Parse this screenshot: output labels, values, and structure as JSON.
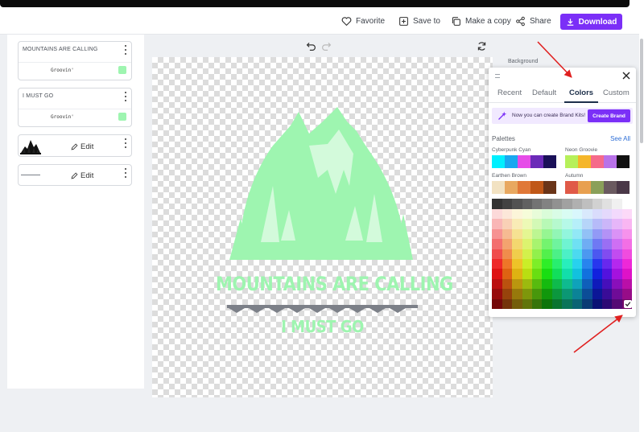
{
  "toolbar": {
    "favorite": "Favorite",
    "save_to": "Save to",
    "make_copy": "Make a copy",
    "share": "Share",
    "download": "Download"
  },
  "layers": [
    {
      "title": "MOUNTAINS ARE CALLING",
      "font": "Groovin'",
      "color": "#9ef5b0"
    },
    {
      "title": "I MUST GO",
      "font": "Groovin'",
      "color": "#9ef5b0"
    },
    {
      "edit_label": "Edit"
    },
    {
      "edit_label": "Edit"
    }
  ],
  "design": {
    "title_text": "MOUNTAINS ARE CALLING",
    "sub_text": "I MUST GO",
    "color": "#9ef5b0"
  },
  "background_label": "Background",
  "color_panel": {
    "tabs": [
      {
        "label": "Recent",
        "active": false
      },
      {
        "label": "Default",
        "active": false
      },
      {
        "label": "Colors",
        "active": true
      },
      {
        "label": "Custom",
        "active": false
      }
    ],
    "promo_text": "Now you can create Brand Kits!",
    "promo_button": "Create Brand",
    "palettes_label": "Palettes",
    "see_all": "See All",
    "palettes": [
      {
        "name": "Cyberpunk Cyan",
        "colors": [
          "#00f0ff",
          "#1aa8f0",
          "#e64ce8",
          "#6b2ab8",
          "#1a1058"
        ]
      },
      {
        "name": "Neon Groovie",
        "colors": [
          "#b6f05a",
          "#f5b62a",
          "#f56a8a",
          "#b872e8",
          "#111111"
        ]
      },
      {
        "name": "Earthen Brown",
        "colors": [
          "#f2e2c2",
          "#e8a860",
          "#e07838",
          "#c05818",
          "#6a3418"
        ]
      },
      {
        "name": "Autumn",
        "colors": [
          "#e05a48",
          "#e8a050",
          "#8aa05a",
          "#6a5a60",
          "#4a3848"
        ]
      }
    ]
  }
}
